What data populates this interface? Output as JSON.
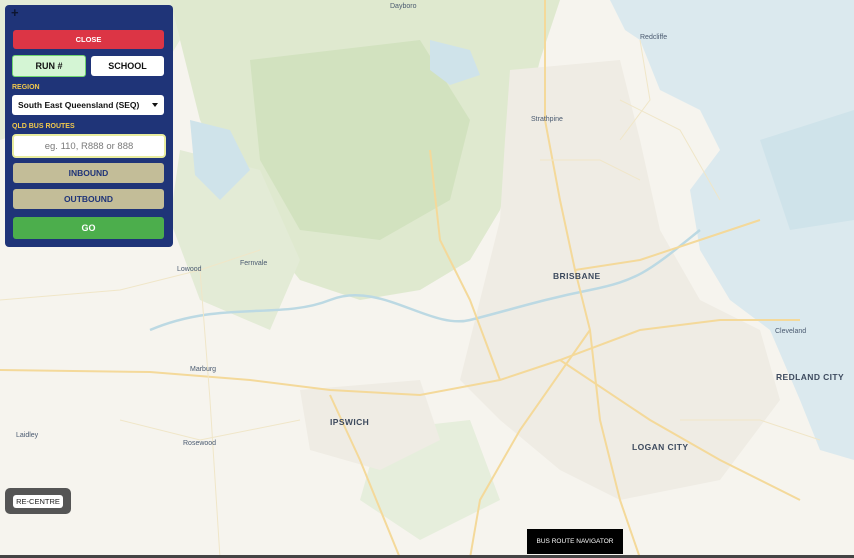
{
  "panel": {
    "close_label": "CLOSE",
    "run_label": "RUN #",
    "school_label": "SCHOOL",
    "region_label": "REGION",
    "region_selected": "South East Queensland (SEQ)",
    "routes_label": "QLD BUS ROUTES",
    "routes_placeholder": "eg. 110, R888 or 888",
    "inbound_label": "INBOUND",
    "outbound_label": "OUTBOUND",
    "go_label": "GO"
  },
  "recentre_label": "RE-CENTRE",
  "footer_label": "BUS ROUTE NAVIGATOR",
  "map": {
    "places": {
      "dayboro": "Dayboro",
      "redcliffe": "Redcliffe",
      "strathpine": "Strathpine",
      "brisbane": "BRISBANE",
      "lowood": "Lowood",
      "fernvale": "Fernvale",
      "cleveland": "Cleveland",
      "marburg": "Marburg",
      "redland_city": "REDLAND CITY",
      "ipswich": "IPSWICH",
      "laidley": "Laidley",
      "rosewood": "Rosewood",
      "logan_city": "LOGAN CITY"
    }
  }
}
